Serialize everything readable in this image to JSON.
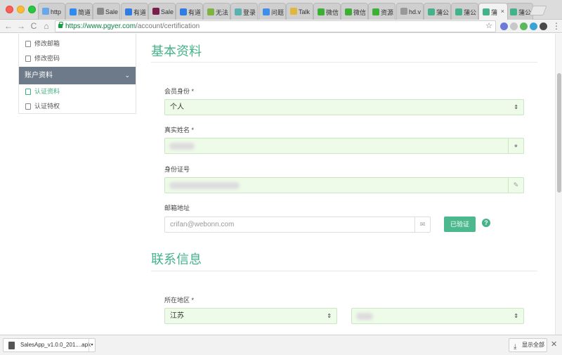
{
  "tabs": [
    {
      "label": "http",
      "color": "#6aa7e8"
    },
    {
      "label": "简道",
      "color": "#2d8cf0"
    },
    {
      "label": "Sale",
      "color": "#888888"
    },
    {
      "label": "有道",
      "color": "#2f7de1"
    },
    {
      "label": "Sale",
      "color": "#7a1f4c"
    },
    {
      "label": "有道",
      "color": "#2f7de1"
    },
    {
      "label": "无法",
      "color": "#7cb342"
    },
    {
      "label": "登录",
      "color": "#5bb0b0"
    },
    {
      "label": "问题",
      "color": "#3f8ee8"
    },
    {
      "label": "Talk",
      "color": "#e0b73a"
    },
    {
      "label": "微信",
      "color": "#3cb034"
    },
    {
      "label": "微信",
      "color": "#3cb034"
    },
    {
      "label": "资源",
      "color": "#3cb034"
    },
    {
      "label": "hd.v",
      "color": "#999999"
    },
    {
      "label": "蒲公",
      "color": "#45b38a"
    },
    {
      "label": "蒲公",
      "color": "#45b38a"
    },
    {
      "label": "蒲",
      "color": "#45b38a"
    },
    {
      "label": "蒲公",
      "color": "#45b38a"
    }
  ],
  "tab_close": "×",
  "toolbar": {
    "back": "←",
    "forward": "→",
    "reload": "C",
    "home": "⌂",
    "url_secure": "https://www.pgyer.com",
    "url_path": "/account/certification",
    "bookmark_star": "☆",
    "menu": "⋮"
  },
  "extension_colors": [
    "#6b7ad8",
    "#c8c8c8",
    "#5cb85c",
    "#3aa3d6",
    "#4a4a4a"
  ],
  "sidebar": {
    "items_top": [
      {
        "label": "修改邮箱"
      },
      {
        "label": "修改密码"
      }
    ],
    "section_header": "账户资料",
    "section_chevron": "⌄",
    "items_bottom": [
      {
        "label": "认证资料",
        "active": true
      },
      {
        "label": "认证特权",
        "active": false
      }
    ]
  },
  "form": {
    "section1_title": "基本资料",
    "member_type": {
      "label": "会员身份",
      "required": "*",
      "value": "个人"
    },
    "real_name": {
      "label": "真实姓名",
      "required": "*"
    },
    "id_number": {
      "label": "身份证号"
    },
    "email": {
      "label": "邮箱地址",
      "placeholder": "crifan@webonn.com",
      "verify_button": "已验证",
      "help": "?"
    },
    "section2_title": "联系信息",
    "region": {
      "label": "所在地区",
      "required": "*",
      "province": "江苏"
    },
    "select_caret": "⇕"
  },
  "downloads": {
    "file_name": "SalesApp_v1.0.0_201....apk",
    "show_all": "显示全部",
    "close": "✕"
  }
}
